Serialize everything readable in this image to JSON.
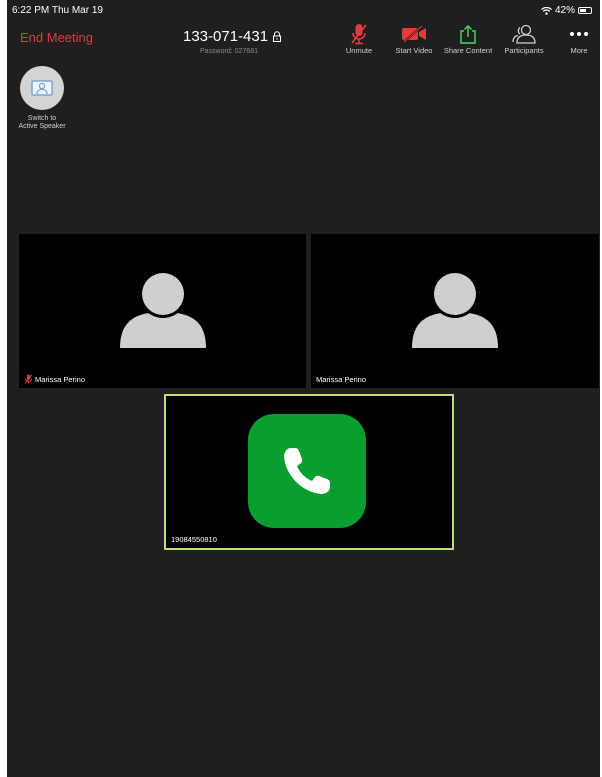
{
  "status_bar": {
    "time": "6:22 PM  Thu Mar 19",
    "battery": "42%"
  },
  "toolbar": {
    "end_meeting": "End Meeting",
    "meeting_id": "133-071-431",
    "password": "Password: 027681",
    "buttons": [
      {
        "label": "Unmute",
        "icon": "mic-muted-icon"
      },
      {
        "label": "Start Video",
        "icon": "video-off-icon"
      },
      {
        "label": "Share Content",
        "icon": "share-icon"
      },
      {
        "label": "Participants",
        "icon": "participants-icon"
      },
      {
        "label": "More",
        "icon": "more-icon"
      }
    ]
  },
  "switch_speaker": {
    "label": "Switch to\nActive Speaker"
  },
  "tiles": [
    {
      "name": "Marissa Perino",
      "muted": true
    },
    {
      "name": "Marissa Perino",
      "muted": false
    },
    {
      "name": "19084550810",
      "type": "phone"
    }
  ],
  "colors": {
    "end_meeting": "#e23b3b",
    "active_border": "#b7e27a",
    "phone_green": "#0a9e2f",
    "share_green": "#4cd964"
  }
}
